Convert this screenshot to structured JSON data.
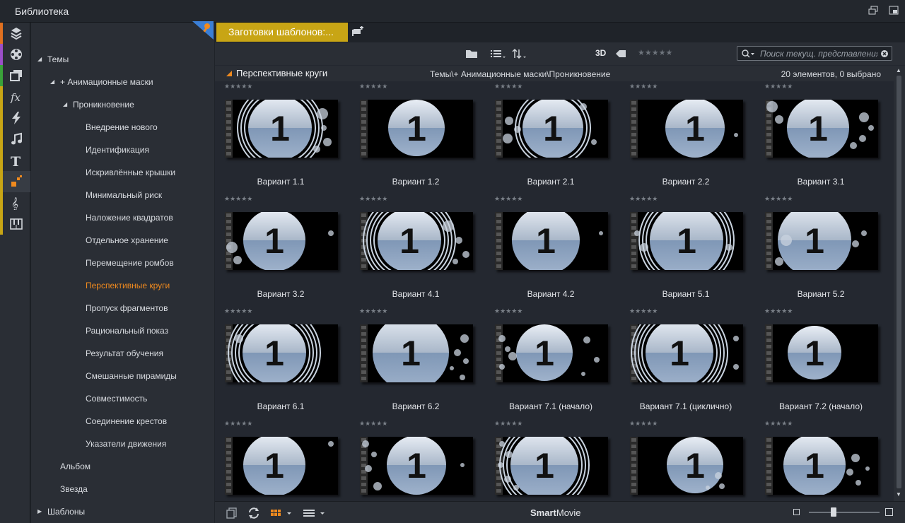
{
  "window": {
    "title": "Библиотека"
  },
  "strip": {
    "colors": [
      "#e07020",
      "#9b4fc8",
      "#3aa23a",
      "#c8a515",
      "#c8a515",
      "#c8a515",
      "#c8a515",
      "#c8a515",
      "#c8a515",
      "#c8a515"
    ],
    "icons": [
      "box-stack-icon",
      "film-reel-icon",
      "photos-icon",
      "fx-icon",
      "lightning-icon",
      "music-note-icon",
      "text-t-icon",
      "montage-squares-icon",
      "treble-clef-icon",
      "piano-keys-icon"
    ],
    "active_index": 7
  },
  "tree": {
    "items": [
      {
        "label": "Темы",
        "arrow": "◢"
      },
      {
        "label": "+ Анимационные маски",
        "arrow": "◢"
      },
      {
        "label": "Проникновение",
        "arrow": "◢"
      },
      {
        "label": "Внедрение нового"
      },
      {
        "label": "Идентификация"
      },
      {
        "label": "Искривлённые крышки"
      },
      {
        "label": "Минимальный риск"
      },
      {
        "label": "Наложение квадратов"
      },
      {
        "label": "Отдельное хранение"
      },
      {
        "label": "Перемещение ромбов"
      },
      {
        "label": "Перспективные круги",
        "selected": true
      },
      {
        "label": "Пропуск фрагментов"
      },
      {
        "label": "Рациональный показ"
      },
      {
        "label": "Результат обучения"
      },
      {
        "label": "Смешанные пирамиды"
      },
      {
        "label": "Совместимость"
      },
      {
        "label": "Соединение крестов"
      },
      {
        "label": "Указатели движения"
      },
      {
        "label": "Альбом"
      },
      {
        "label": "Звезда"
      },
      {
        "label": "Шаблоны",
        "arrow": "▶"
      }
    ]
  },
  "tab": {
    "label": "Заготовки шаблонов:..."
  },
  "toolbar": {
    "label_3d": "3D",
    "stars": "★★★★★",
    "search_placeholder": "Поиск текущ. представления"
  },
  "pathbar": {
    "collection": "Перспективные круги",
    "path": "Темы\\+ Анимационные маски\\Проникновение",
    "count": "20 элементов, 0 выбрано"
  },
  "grid": {
    "stars": "★★★★★",
    "thumb_number": "1",
    "items": [
      {
        "label": "Вариант 1.1"
      },
      {
        "label": "Вариант 1.2"
      },
      {
        "label": "Вариант 2.1"
      },
      {
        "label": "Вариант 2.2"
      },
      {
        "label": "Вариант 3.1"
      },
      {
        "label": "Вариант 3.2"
      },
      {
        "label": "Вариант 4.1"
      },
      {
        "label": "Вариант 4.2"
      },
      {
        "label": "Вариант 5.1"
      },
      {
        "label": "Вариант 5.2"
      },
      {
        "label": "Вариант 6.1"
      },
      {
        "label": "Вариант 6.2"
      },
      {
        "label": "Вариант 7.1 (начало)"
      },
      {
        "label": "Вариант 7.1 (циклично)"
      },
      {
        "label": "Вариант 7.2 (начало)"
      },
      {
        "label": ""
      },
      {
        "label": ""
      },
      {
        "label": ""
      },
      {
        "label": ""
      },
      {
        "label": ""
      }
    ]
  },
  "bottombar": {
    "brand_bold": "Smart",
    "brand_rest": "Movie",
    "zoom": 0.35
  },
  "colors": {
    "accent": "#f08a1e",
    "tab": "#c8a515"
  }
}
